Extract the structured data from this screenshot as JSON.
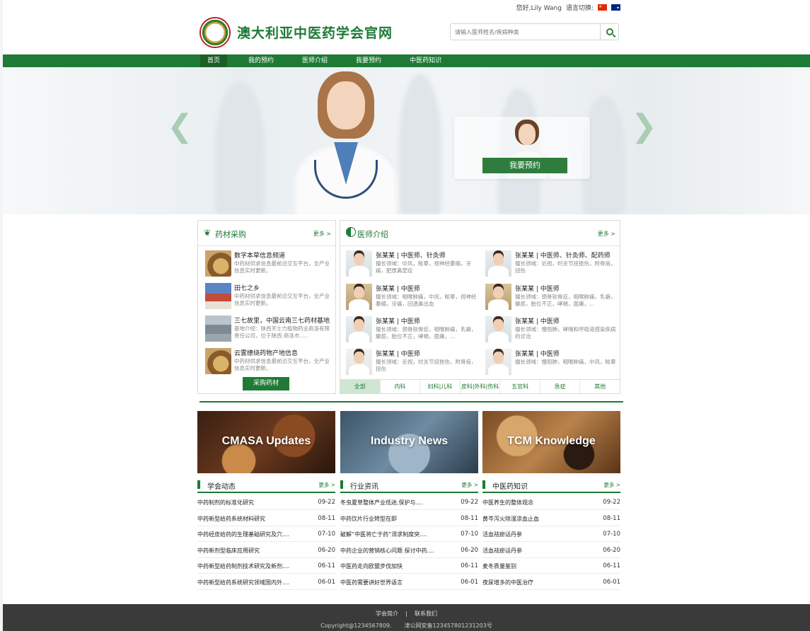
{
  "topbar": {
    "greeting": "您好,Lily Wang",
    "language_label": "语言切换:",
    "languages": [
      "cn-flag-icon",
      "au-flag-icon"
    ]
  },
  "header": {
    "title": "澳大利亚中医药学会官网",
    "search_placeholder": "请输入医师姓名/疾病种类",
    "search_icon": "search-icon"
  },
  "nav": {
    "items": [
      "首页",
      "我的预约",
      "医师介绍",
      "我要预约",
      "中医药知识"
    ],
    "active": 0
  },
  "banner": {
    "cta": "我要预约",
    "prev": "❮",
    "next": "❯"
  },
  "herbs": {
    "title": "药材采购",
    "more": "更多 >",
    "items": [
      {
        "name": "数字本草信息频道",
        "desc": "中药材供求信息最前沿交互平台，全产业信息实时更新。"
      },
      {
        "name": "田七之乡",
        "desc": "中药材供求信息最前沿交互平台，全产业信息实时更新。"
      },
      {
        "name": "三七故里，中国云南三七药材基地",
        "desc": "基地介绍：陕西天士力植物药业商洛有限责任公司，位于陕西 商洛市....."
      },
      {
        "name": "云雾缭绕药物产地信息",
        "desc": "中药材供求信息最前沿交互平台，全产业信息实时更新。"
      }
    ],
    "button": "采购药材"
  },
  "doctors": {
    "title": "医师介绍",
    "more": "更多 >",
    "items": [
      {
        "name": "张某某 | 中医师、针灸师",
        "desc": "擅长领域：中风，眩晕，视神经萎缩，牙痛，肥厚鼻窦症"
      },
      {
        "name": "张某某 | 中医师、针灸师、配药师",
        "desc": "擅长领域：近视，时关节扭挫伤，附骨疽，扭伤"
      },
      {
        "name": "张某某 | 中医师",
        "desc": "擅长领域：咽喉肿痛，中风，眩晕，视神经萎缩，牙痛，回遗鼻出血"
      },
      {
        "name": "张某某 | 中医师",
        "desc": "擅长领域：颈骨软骨症，咽喉肿痛，乳癖，瘰疬，胎位不正，哮喘，面瘫，..."
      },
      {
        "name": "张某某 | 中医师",
        "desc": "擅长领域：颈骨软骨症，咽喉肿痛，乳癖，瘰疬，胎位不正，哮喘，面瘫，..."
      },
      {
        "name": "张某某 | 中医师",
        "desc": "擅长领域：慢阻肺，哮喘和呼吸道感染疾病的诊治"
      },
      {
        "name": "张某某 | 中医师",
        "desc": "擅长领域：近视，时关节扭挫伤，附骨疽，扭伤"
      },
      {
        "name": "张某某 | 中医师",
        "desc": "擅长领域：慢阻肺，咽喉肿痛，中风，眩晕"
      }
    ],
    "tabs": [
      "全部",
      "内科",
      "妇科|儿科",
      "皮科|外科|伤科",
      "五官科",
      "急症",
      "其他"
    ],
    "active_tab": 0
  },
  "cards": [
    {
      "title": "CMASA Updates"
    },
    {
      "title": "Industry News"
    },
    {
      "title": "TCM Knowledge"
    }
  ],
  "columns": [
    {
      "title": "学会动态",
      "more": "更多 >",
      "rows": [
        {
          "t": "中药制剂的标准化研究",
          "d": "09-22"
        },
        {
          "t": "中药新型给药系统材料研究",
          "d": "08-11"
        },
        {
          "t": "中药经皮给药的生理基础研究及穴....",
          "d": "07-10"
        },
        {
          "t": "中药新剂型临床应用研究",
          "d": "06-20"
        },
        {
          "t": "中药新型给药制剂技术研究及新剂....",
          "d": "06-11"
        },
        {
          "t": "中药新型给药系统研究领域国内外....",
          "d": "06-01"
        }
      ]
    },
    {
      "title": "行业资讯",
      "more": "更多 >",
      "rows": [
        {
          "t": "冬虫夏草整体产业低迷,保护与....",
          "d": "09-22"
        },
        {
          "t": "中药饮片行业转型在即",
          "d": "08-11"
        },
        {
          "t": "破解“中医将亡于药”须求制度突....",
          "d": "07-10"
        },
        {
          "t": "中药企业的营销核心问题 探讨中药....",
          "d": "06-20"
        },
        {
          "t": "中医药走向欧盟步伐加快",
          "d": "06-11"
        },
        {
          "t": "中医药需要讲好世界语言",
          "d": "06-01"
        }
      ]
    },
    {
      "title": "中医药知识",
      "more": "更多 >",
      "rows": [
        {
          "t": "中医养生的整体观念",
          "d": "09-22"
        },
        {
          "t": "黄芩泻火除湿凉血止血",
          "d": "08-11"
        },
        {
          "t": "活血祛瘀话丹参",
          "d": "07-10"
        },
        {
          "t": "活血祛瘀话丹参",
          "d": "06-20"
        },
        {
          "t": "麦冬质量鉴别",
          "d": "06-11"
        },
        {
          "t": "夜尿增多的中医治疗",
          "d": "06-01"
        }
      ]
    }
  ],
  "footer": {
    "links": [
      "学会简介",
      "联系我们"
    ],
    "separator": "|",
    "copyright": "Copyright@1234567809.",
    "icp": "津公网安备123457801231203号"
  },
  "colors": {
    "brand": "#1e7a34",
    "nav_active": "#1a5e28",
    "footer": "#3a3a3a"
  }
}
